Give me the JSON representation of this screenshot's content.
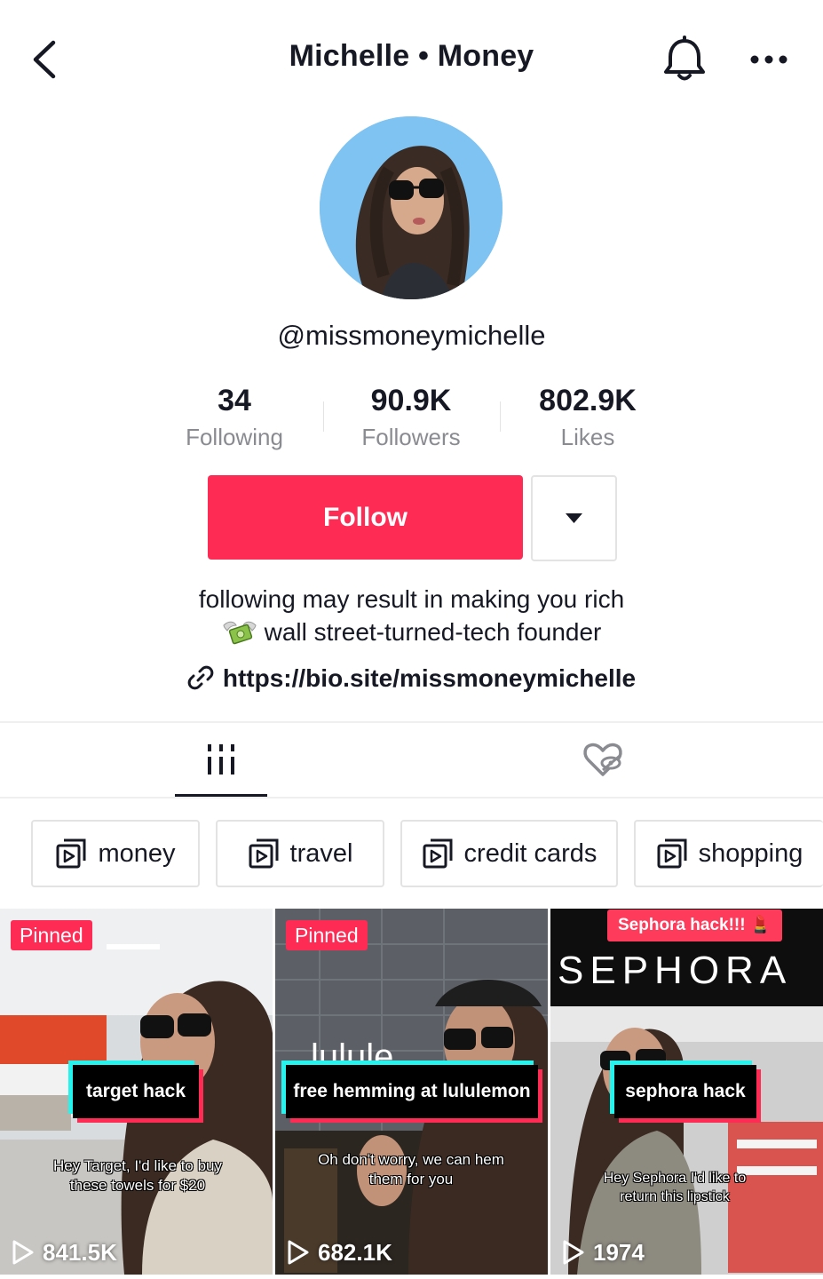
{
  "header": {
    "title": "Michelle • Money",
    "back_icon": "chevron-left-icon",
    "bell_icon": "bell-icon",
    "more_icon": "more-dots-icon"
  },
  "profile": {
    "username": "@missmoneymichelle",
    "stats": [
      {
        "value": "34",
        "label": "Following"
      },
      {
        "value": "90.9K",
        "label": "Followers"
      },
      {
        "value": "802.9K",
        "label": "Likes"
      }
    ],
    "follow_label": "Follow",
    "bio_line1": "following may result in making you rich",
    "bio_line2": "wall street-turned-tech founder",
    "bio_emoji": "money-with-wings-emoji",
    "link": "https://bio.site/missmoneymichelle"
  },
  "tabs": [
    {
      "name": "videos",
      "icon": "grid-icon",
      "active": true
    },
    {
      "name": "liked",
      "icon": "liked-hidden-icon",
      "active": false
    }
  ],
  "playlists": [
    "money",
    "travel",
    "credit cards",
    "shopping"
  ],
  "videos": [
    {
      "pinned": "Pinned",
      "title": "target hack",
      "caption_l1": "Hey Target, I'd like to buy",
      "caption_l2": "these towels for $20",
      "views": "841.5K"
    },
    {
      "pinned": "Pinned",
      "title": "free hemming at lululemon",
      "caption_l1": "Oh don't worry, we can hem",
      "caption_l2": "them for you",
      "views": "682.1K"
    },
    {
      "banner": "Sephora hack!!! 💄",
      "store": "SEPHORA",
      "title": "sephora hack",
      "caption_l1": "Hey Sephora I'd like to",
      "caption_l2": "return this lipstick",
      "views": "1974"
    }
  ],
  "colors": {
    "accent": "#fe2c55",
    "text": "#161823",
    "muted": "#8a8b91",
    "cyan": "#25f4ee"
  }
}
